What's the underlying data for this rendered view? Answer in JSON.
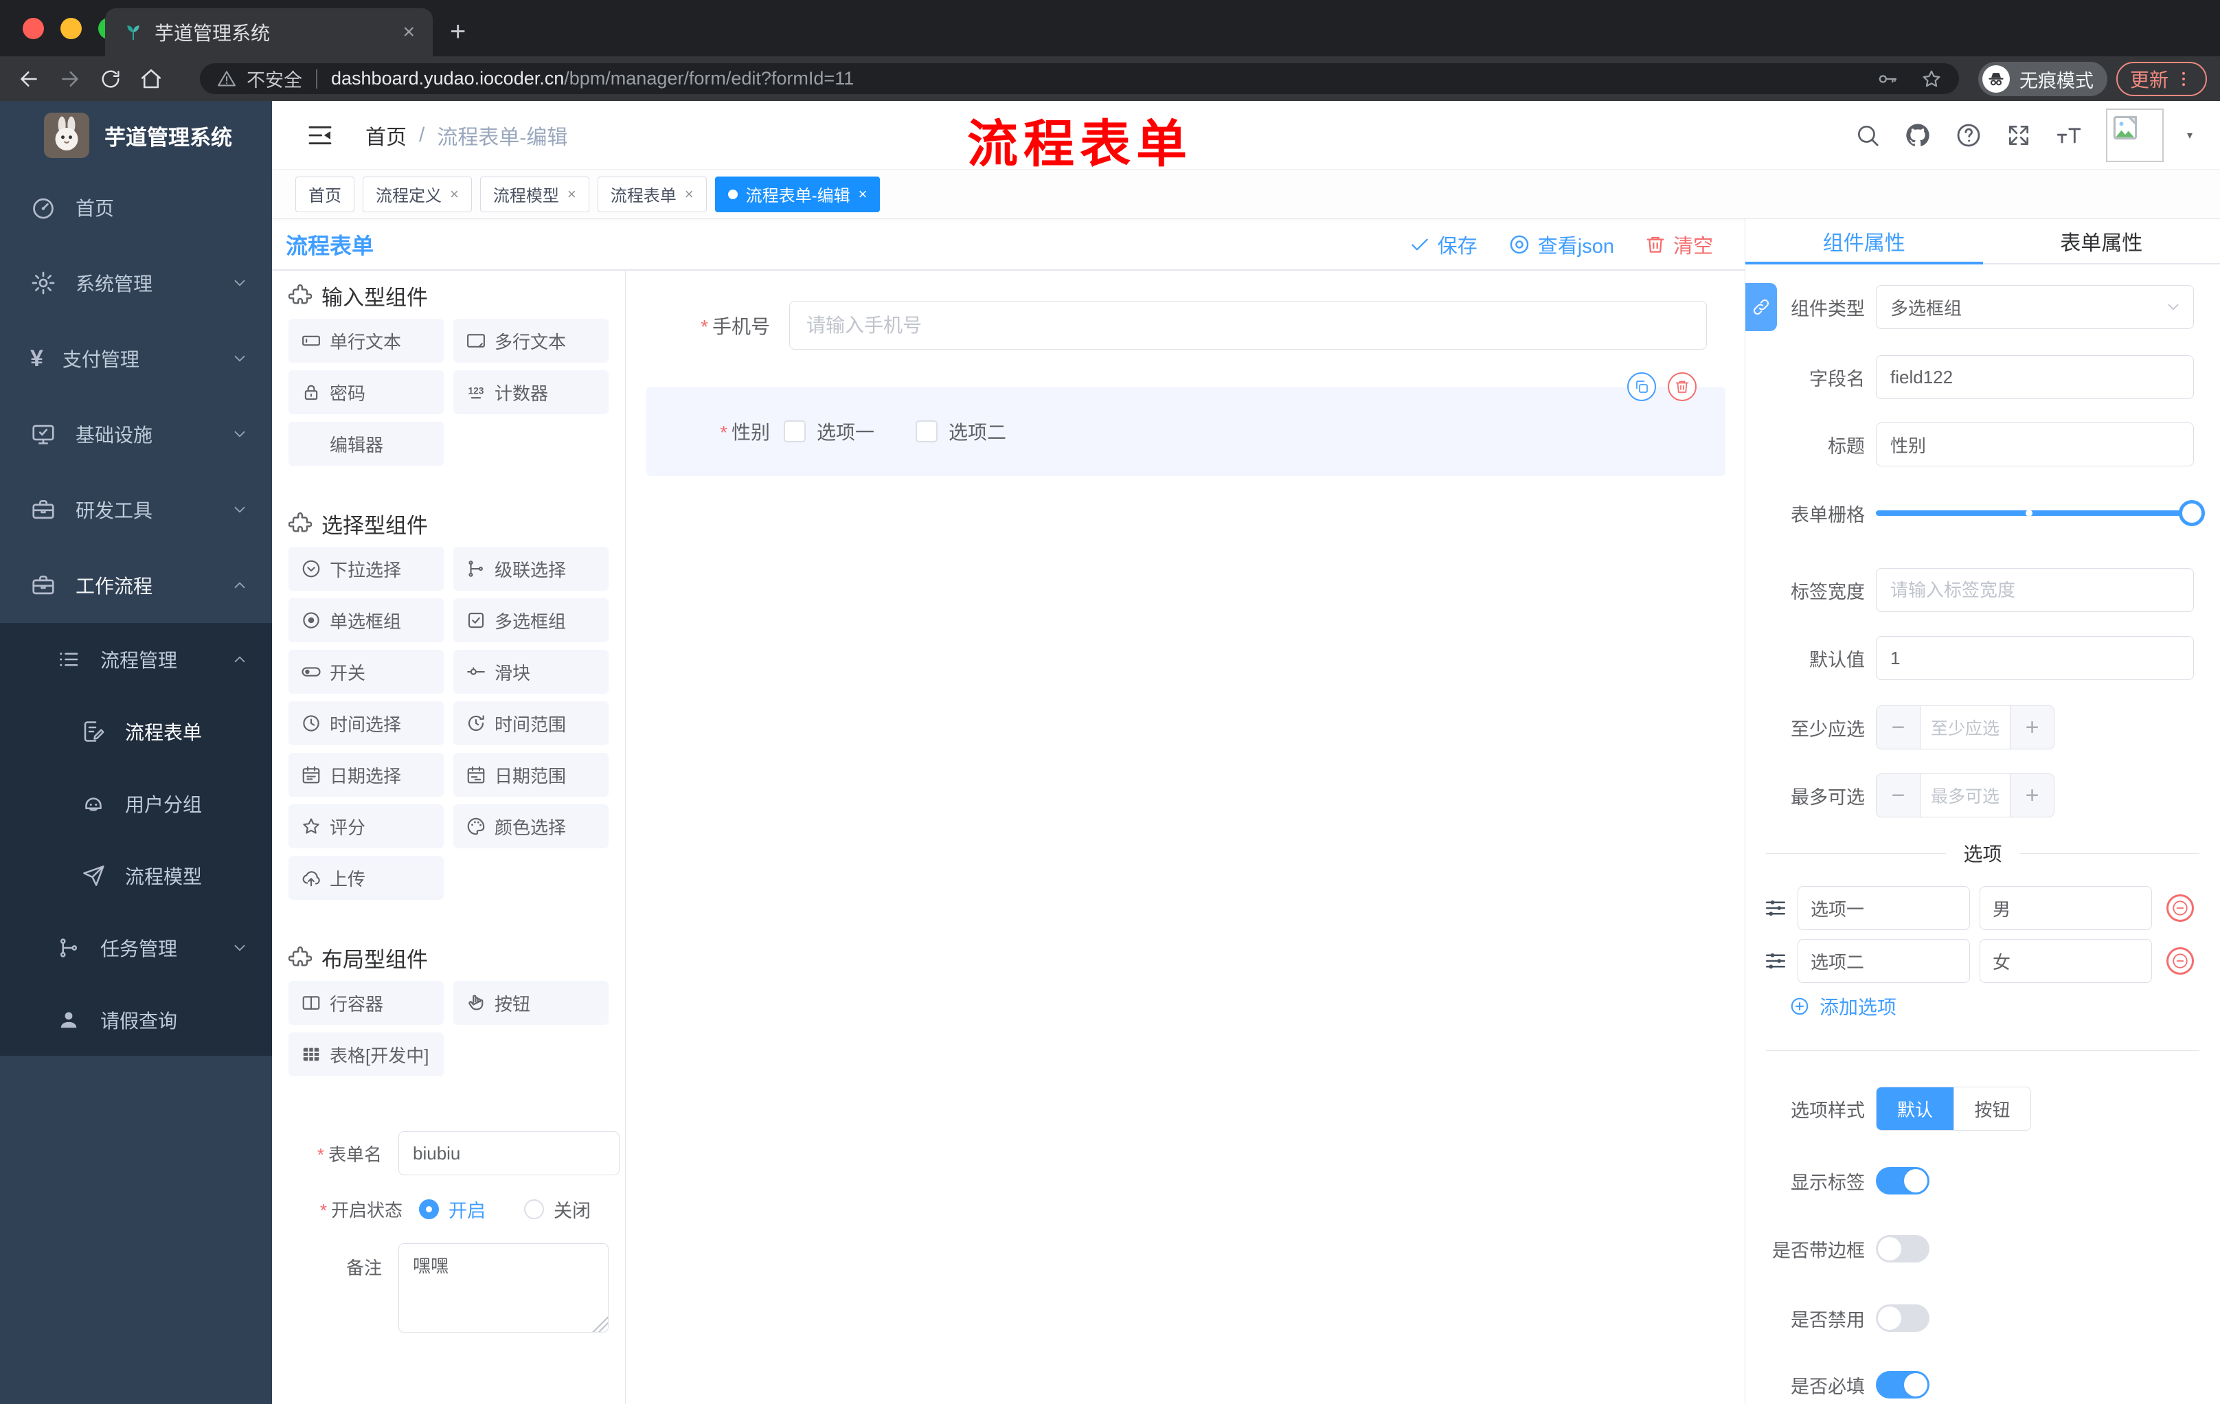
{
  "glyphs": {
    "close": "×",
    "plus_tab": "+",
    "yen": "¥",
    "slash": "/",
    "required": "*",
    "minus": "−",
    "plus": "+",
    "caret": "▾"
  },
  "browser": {
    "tab_title": "芋道管理系统",
    "security_label": "不安全",
    "url_domain": "dashboard.yudao.iocoder.cn",
    "url_path": "/bpm/manager/form/edit?formId=11",
    "incognito_label": "无痕模式",
    "update_label": "更新"
  },
  "sidebar": {
    "brand": "芋道管理系统",
    "items": [
      {
        "label": "首页"
      },
      {
        "label": "系统管理"
      },
      {
        "label": "支付管理"
      },
      {
        "label": "基础设施"
      },
      {
        "label": "研发工具"
      },
      {
        "label": "工作流程"
      },
      {
        "label": "流程管理"
      },
      {
        "label": "流程表单"
      },
      {
        "label": "用户分组"
      },
      {
        "label": "流程模型"
      },
      {
        "label": "任务管理"
      },
      {
        "label": "请假查询"
      }
    ]
  },
  "header": {
    "breadcrumb_home": "首页",
    "breadcrumb_current": "流程表单-编辑",
    "annotation": "流程表单",
    "annotation_color": "#ff0000"
  },
  "tags": {
    "items": [
      {
        "label": "首页"
      },
      {
        "label": "流程定义"
      },
      {
        "label": "流程模型"
      },
      {
        "label": "流程表单"
      },
      {
        "label": "流程表单-编辑"
      }
    ]
  },
  "toolbar": {
    "title": "流程表单",
    "save_label": "保存",
    "view_json_label": "查看json",
    "clear_label": "清空"
  },
  "components": {
    "sections": [
      {
        "title": "输入型组件",
        "items": [
          "单行文本",
          "多行文本",
          "密码",
          "计数器",
          "编辑器"
        ]
      },
      {
        "title": "选择型组件",
        "items": [
          "下拉选择",
          "级联选择",
          "单选框组",
          "多选框组",
          "开关",
          "滑块",
          "时间选择",
          "时间范围",
          "日期选择",
          "日期范围",
          "评分",
          "颜色选择",
          "上传"
        ]
      },
      {
        "title": "布局型组件",
        "items": [
          "行容器",
          "按钮",
          "表格[开发中]"
        ]
      }
    ],
    "form": {
      "name_label": "表单名",
      "name_value": "biubiu",
      "status_label": "开启状态",
      "status_on": "开启",
      "status_off": "关闭",
      "remark_label": "备注",
      "remark_value": "嘿嘿"
    }
  },
  "canvas": {
    "phone_label": "手机号",
    "phone_placeholder": "请输入手机号",
    "gender_label": "性别",
    "gender_option1": "选项一",
    "gender_option2": "选项二"
  },
  "props": {
    "tab_component": "组件属性",
    "tab_form": "表单属性",
    "component_type_label": "组件类型",
    "component_type_value": "多选框组",
    "field_name_label": "字段名",
    "field_name_value": "field122",
    "title_label": "标题",
    "title_value": "性别",
    "grid_label": "表单栅格",
    "label_width_label": "标签宽度",
    "label_width_placeholder": "请输入标签宽度",
    "default_label": "默认值",
    "default_value": "1",
    "min_label": "至少应选",
    "min_placeholder": "至少应选",
    "max_label": "最多可选",
    "max_placeholder": "最多可选",
    "options_divider": "选项",
    "options": [
      {
        "label": "选项一",
        "value": "男"
      },
      {
        "label": "选项二",
        "value": "女"
      }
    ],
    "add_option_label": "添加选项",
    "style_label": "选项样式",
    "style_default": "默认",
    "style_button": "按钮",
    "switch_show_label": "显示标签",
    "switch_border": "是否带边框",
    "switch_disabled": "是否禁用",
    "switch_required": "是否必填"
  },
  "colors": {
    "accent": "#409eff",
    "danger": "#f56c6c",
    "active_tag": "#1890ff",
    "sidebar_bg": "#304156",
    "submenu_bg": "#1f2d3d"
  }
}
